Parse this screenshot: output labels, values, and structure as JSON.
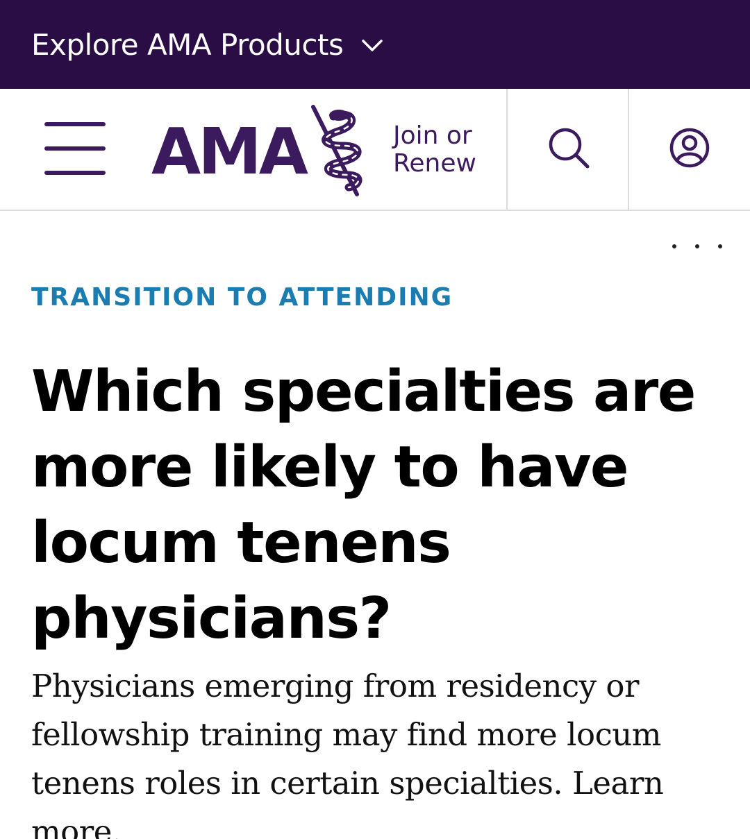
{
  "topbar": {
    "label": "Explore AMA Products",
    "icon": "chevron-down-icon"
  },
  "header": {
    "logo_text": "AMA",
    "join_line1": "Join or",
    "join_line2": "Renew",
    "icons": [
      "menu-icon",
      "search-icon",
      "account-icon"
    ]
  },
  "colors": {
    "topbar_bg": "#2a0d45",
    "brand_purple": "#3b1a5e",
    "category_blue": "#1a7cb0"
  },
  "article": {
    "category": "TRANSITION TO ATTENDING",
    "title": "Which specialties are more likely to have locum tenens physicians?",
    "dek": "Physicians emerging from residency or fellowship training may find more locum tenens roles in certain specialties. Learn more."
  }
}
